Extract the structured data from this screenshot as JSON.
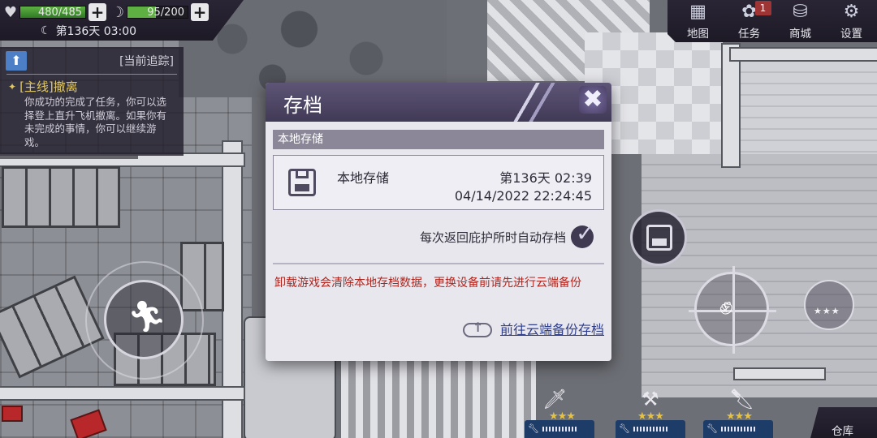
{
  "status": {
    "health": "480/485",
    "stamina": "95/200",
    "day_time": "第136天 03:00"
  },
  "tracker": {
    "header": "[当前追踪]",
    "quest_title": "[主线]撤离",
    "quest_text": "你成功的完成了任务，你可以选择登上直升飞机撤离。如果你有未完成的事情，你可以继续游戏。"
  },
  "topmenu": {
    "map": "地图",
    "tasks": "任务",
    "tasks_badge": "1",
    "shop": "商城",
    "settings": "设置"
  },
  "dialog": {
    "title": "存档",
    "section": "本地存储",
    "slot": {
      "name": "本地存储",
      "day": "第136天 02:39",
      "datetime": "04/14/2022 22:24:45"
    },
    "autosave_label": "每次返回庇护所时自动存档",
    "autosave_checked": true,
    "warning": "卸载游戏会清除本地存档数据，更换设备前请先进行云端备份",
    "cloud_link": "前往云端备份存档"
  },
  "weapon_rating": "★★★",
  "quickslots": [
    {
      "stars": "★★★"
    },
    {
      "stars": "★★★"
    },
    {
      "stars": "★★★"
    }
  ],
  "warehouse": "仓库",
  "colors": {
    "hud_bg": "#1d1a26",
    "dialog_title": "#413a56",
    "warning_text": "#b0261e",
    "link_text": "#2f3f8e",
    "health_bar": "#5fb043"
  }
}
